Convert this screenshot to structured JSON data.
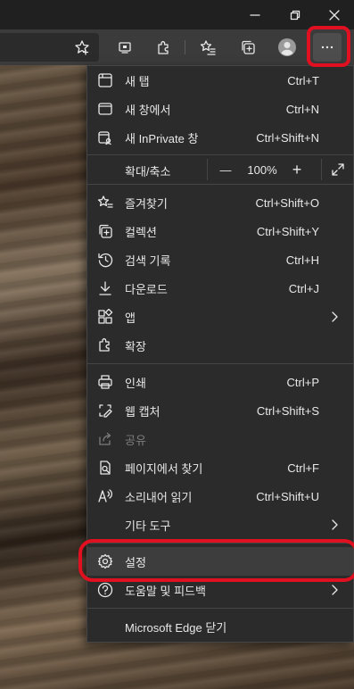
{
  "toolbar": {
    "more_label": "···"
  },
  "menu": {
    "items_top": [
      {
        "label": "새 탭",
        "shortcut": "Ctrl+T"
      },
      {
        "label": "새 창에서",
        "shortcut": "Ctrl+N"
      },
      {
        "label": "새 InPrivate 창",
        "shortcut": "Ctrl+Shift+N"
      }
    ],
    "zoom": {
      "label": "확대/축소",
      "minus": "—",
      "value": "100%",
      "plus": "+"
    },
    "items_mid": [
      {
        "label": "즐겨찾기",
        "shortcut": "Ctrl+Shift+O"
      },
      {
        "label": "컬렉션",
        "shortcut": "Ctrl+Shift+Y"
      },
      {
        "label": "검색 기록",
        "shortcut": "Ctrl+H"
      },
      {
        "label": "다운로드",
        "shortcut": "Ctrl+J"
      },
      {
        "label": "앱",
        "shortcut": ""
      },
      {
        "label": "확장",
        "shortcut": ""
      }
    ],
    "items_low": [
      {
        "label": "인쇄",
        "shortcut": "Ctrl+P"
      },
      {
        "label": "웹 캡처",
        "shortcut": "Ctrl+Shift+S"
      },
      {
        "label": "공유",
        "shortcut": ""
      },
      {
        "label": "페이지에서 찾기",
        "shortcut": "Ctrl+F"
      },
      {
        "label": "소리내어 읽기",
        "shortcut": "Ctrl+Shift+U"
      },
      {
        "label": "기타 도구",
        "shortcut": ""
      },
      {
        "label": "설정",
        "shortcut": ""
      },
      {
        "label": "도움말 및 피드백",
        "shortcut": ""
      }
    ],
    "close_label": "Microsoft Edge 닫기"
  },
  "colors": {
    "menu_bg": "#2b2b2b",
    "highlight": "#e01020",
    "text": "#e8e8e8",
    "disabled_text": "#7c7c7c"
  }
}
